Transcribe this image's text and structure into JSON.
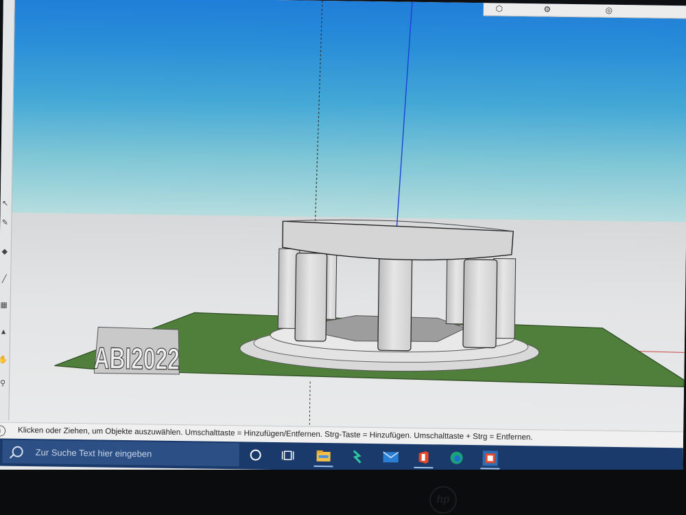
{
  "status_bar": {
    "message": "Klicken oder Ziehen, um Objekte auszuwählen. Umschalttaste = Hinzufügen/Entfernen. Strg-Taste = Hinzufügen. Umschalttaste + Strg = Entfernen.",
    "icon": "info-icon"
  },
  "model": {
    "text_3d": "ABI2022"
  },
  "taskbar": {
    "search_placeholder": "Zur Suche Text hier eingeben",
    "apps": [
      "cortana",
      "task-view",
      "file-explorer",
      "app-4",
      "mail",
      "office",
      "edge",
      "sketchup"
    ]
  },
  "colors": {
    "sky_top": "#1f7ed8",
    "sky_bottom": "#bfe1e0",
    "ground": "#e3e4e5",
    "plane": "#4f7f3a",
    "taskbar": "#1a3a6b"
  }
}
